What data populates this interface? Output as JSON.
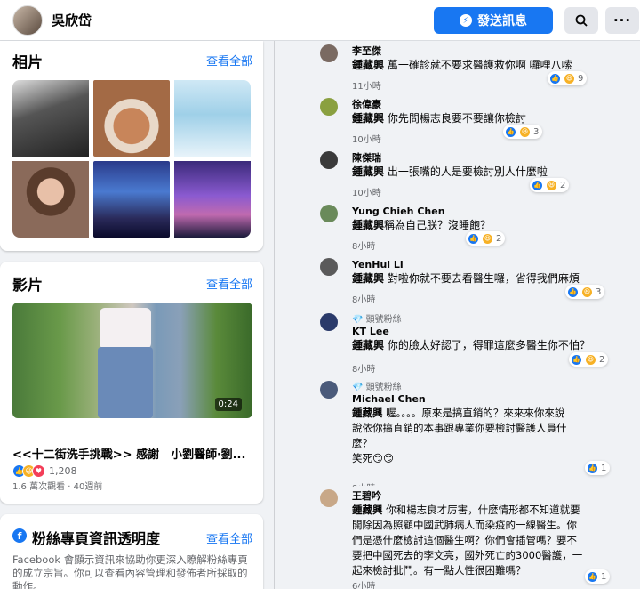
{
  "header": {
    "page_name": "吳欣岱",
    "message_button": "發送訊息",
    "search_icon": "search-icon",
    "more_icon": "more-icon"
  },
  "photos": {
    "title": "相片",
    "see_all": "查看全部"
  },
  "videos": {
    "title": "影片",
    "see_all": "查看全部",
    "duration": "0:24",
    "video_title": "<<十二街洗手挑戰>> 感謝　小劉醫師‧劉...",
    "reaction_count": "1,208",
    "meta": "1.6 萬次觀看 · 40週前"
  },
  "transparency": {
    "title": "粉絲專頁資訊透明度",
    "see_all": "查看全部",
    "text": "Facebook 會顯示資訊來協助你更深入瞭解粉絲專頁的成立宗旨。你可以查看內容管理和發佈者所採取的動作。"
  },
  "comments": [
    {
      "name": "李至傑",
      "badge": "",
      "mention": "鍾藏興",
      "text": " 萬一確診就不要求醫護救你啊 囉哩八嗦",
      "time": "11小時",
      "reactions": "9"
    },
    {
      "name": "徐偉豪",
      "badge": "",
      "mention": "鍾藏興",
      "text": " 你先問楊志良要不要讓你檢討",
      "time": "10小時",
      "reactions": "3"
    },
    {
      "name": "陳傑瑞",
      "badge": "",
      "mention": "鍾藏興",
      "text": " 出一張嘴的人是要檢討別人什麼啦",
      "time": "10小時",
      "reactions": "2"
    },
    {
      "name": "Yung Chieh Chen",
      "badge": "",
      "mention": "鍾藏興",
      "text": "稱為自己朕？沒睡飽？",
      "time": "8小時",
      "reactions": "2"
    },
    {
      "name": "YenHui Li",
      "badge": "",
      "mention": "鍾藏興",
      "text": " 對啦你就不要去看醫生囉，省得我們麻煩",
      "time": "8小時",
      "reactions": "3"
    },
    {
      "name": "KT Lee",
      "badge": "頭號粉絲",
      "mention": "鍾藏興",
      "text": " 你的臉太好認了，得罪這麼多醫生你不怕？",
      "time": "8小時",
      "reactions": "2"
    },
    {
      "name": "Michael Chen",
      "badge": "頭號粉絲",
      "mention": "鍾藏興",
      "text": " 喔。。。。原來是搞直銷的？來來來你來說\n說依你搞直銷的本事跟專業你要檢討醫護人員什\n麼？\n笑死😏😏",
      "time": "8小時",
      "reactions": "1"
    },
    {
      "name": "王碧吟",
      "badge": "",
      "mention": "鍾藏興",
      "text": " 你和楊志良才厉害，什麼情形都不知道就要\n開除因為照顧中國武肺病人而染疫的一線醫生。你\n們是憑什麼檢討這個醫生啊？你們會插管嗎？要不\n要把中國死去的李文亮，國外死亡的3000醫護，一\n起來檢討批鬥。有一點人性很困難嗎？",
      "time": "6小時",
      "reactions": "1"
    }
  ],
  "colors": {
    "accent": "#1877f2",
    "background": "#f0f2f5"
  }
}
